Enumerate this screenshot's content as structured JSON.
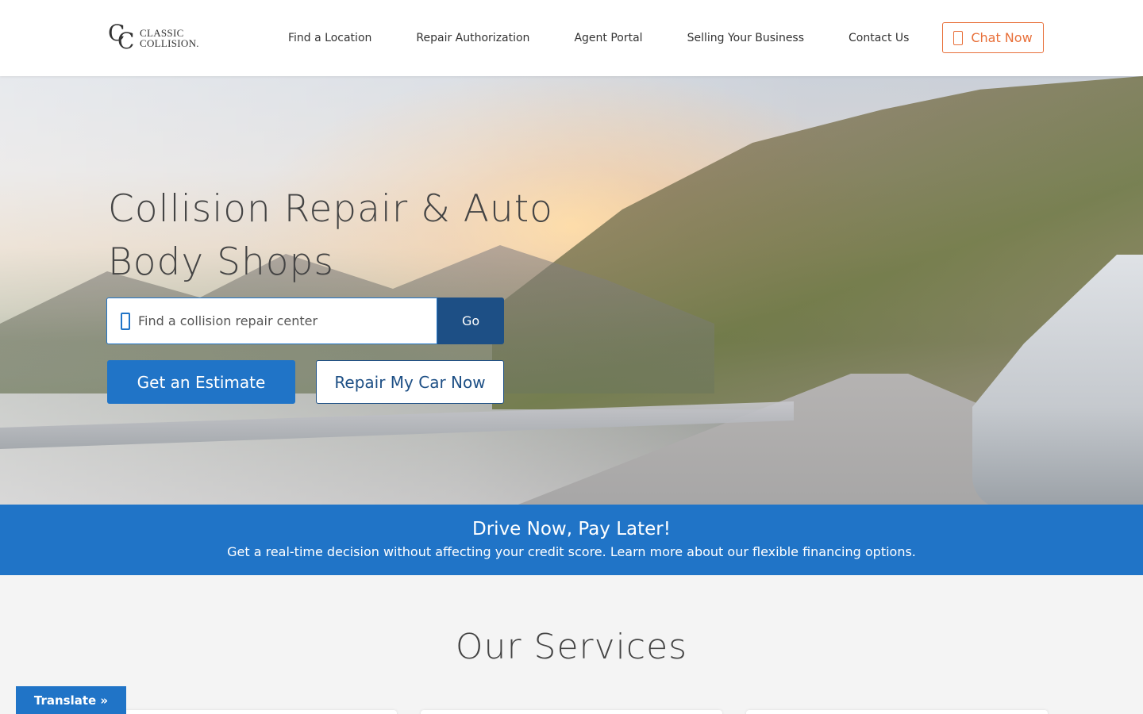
{
  "header": {
    "logo_text_line1": "CLASSIC",
    "logo_text_line2": "COLLISION.",
    "nav": [
      {
        "label": "Find a Location"
      },
      {
        "label": "Repair Authorization"
      },
      {
        "label": "Agent Portal"
      },
      {
        "label": "Selling Your Business"
      },
      {
        "label": "Contact Us"
      }
    ],
    "chat_label": "Chat Now",
    "accent_color": "#e8703a"
  },
  "hero": {
    "title": "Collision Repair & Auto Body Shops",
    "search_placeholder": "Find a collision repair center",
    "go_label": "Go",
    "estimate_label": "Get an Estimate",
    "repair_label": "Repair My Car Now"
  },
  "banner": {
    "title": "Drive Now, Pay Later!",
    "text": "Get a real-time decision without affecting your credit score. Learn more about our flexible financing options.",
    "color": "#2074c7"
  },
  "services": {
    "title": "Our Services"
  },
  "translate_label": "Translate »"
}
